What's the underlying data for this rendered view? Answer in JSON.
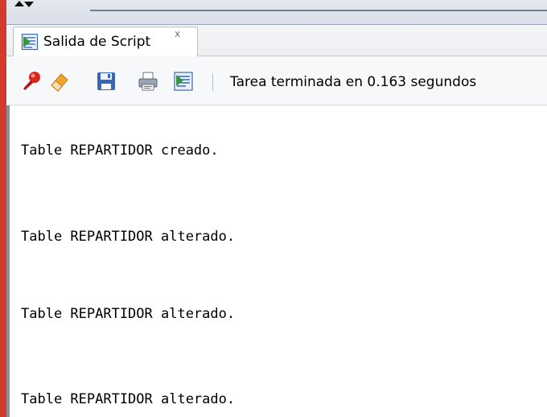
{
  "tab": {
    "label": "Salida de Script",
    "close_label": "x"
  },
  "toolbar": {
    "buttons": [
      {
        "icon": "pin-icon",
        "name": "pin"
      },
      {
        "icon": "eraser-icon",
        "name": "clear"
      },
      {
        "icon": "save-icon",
        "name": "save"
      },
      {
        "icon": "print-icon",
        "name": "print"
      },
      {
        "icon": "script-icon",
        "name": "script"
      }
    ],
    "status_text": "Tarea terminada en 0.163 segundos"
  },
  "output": {
    "lines": [
      "Table REPARTIDOR creado.",
      "Table REPARTIDOR alterado.",
      "Table REPARTIDOR alterado.",
      "Table REPARTIDOR alterado."
    ]
  },
  "colors": {
    "left_border": "#d23b2c",
    "text": "#000000"
  }
}
